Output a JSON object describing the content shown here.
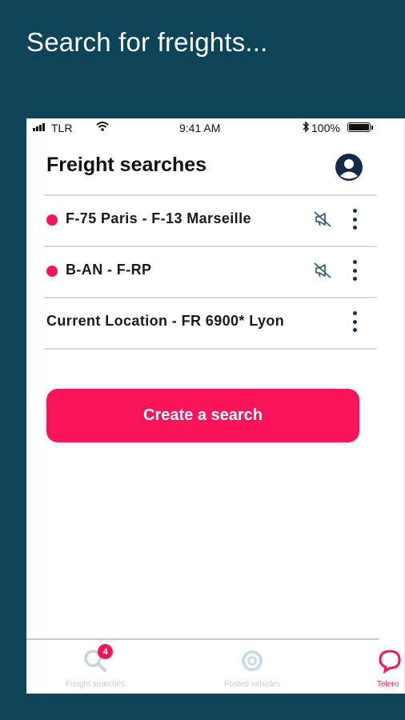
{
  "headline": "Search for freights...",
  "status_bar": {
    "carrier": "TLR",
    "time": "9:41 AM",
    "battery": "100%"
  },
  "page_title": "Freight searches",
  "searches": [
    {
      "label": "F-75 Paris - F-13 Marseille",
      "active": true,
      "notifications_muted": true
    },
    {
      "label": "B-AN - F-RP",
      "active": true,
      "notifications_muted": true
    },
    {
      "label": "Current Location - FR 6900* Lyon",
      "active": false,
      "notifications_muted": false
    }
  ],
  "create_button_label": "Create a search",
  "tab_bar": {
    "freight_searches": {
      "label": "Freight searches",
      "badge": "4"
    },
    "posted_vehicles": {
      "label": "Posted vehicles"
    },
    "third_tab_partial": {
      "label": "Telero"
    }
  },
  "colors": {
    "background": "#0d4458",
    "accent": "#f8145a",
    "text": "#1a1a1a"
  }
}
